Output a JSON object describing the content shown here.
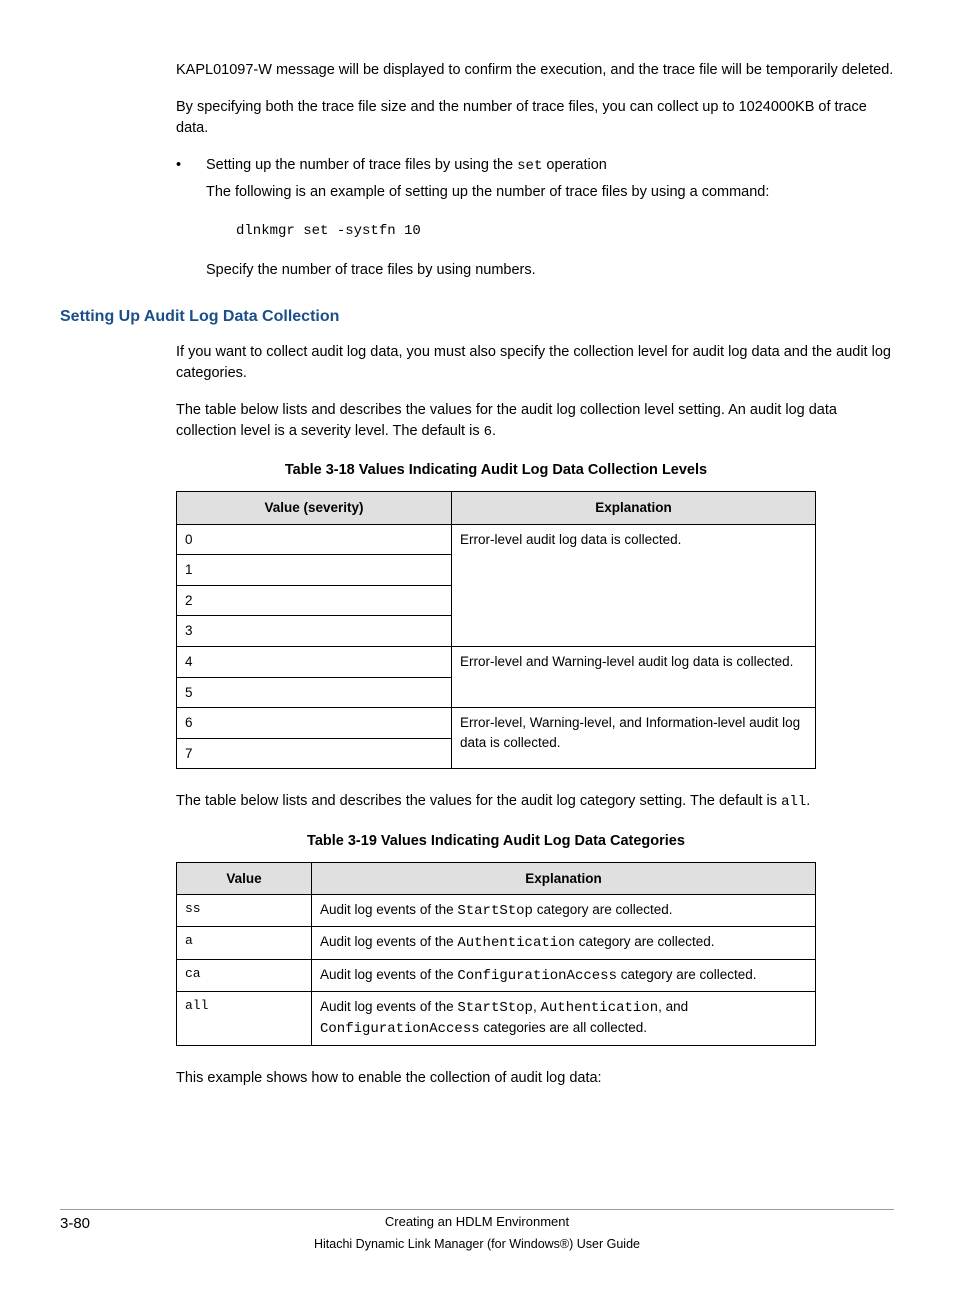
{
  "para1": "KAPL01097-W message will be displayed to confirm the execution, and the trace file will be temporarily deleted.",
  "para2": "By specifying both the trace file size and the number of trace files, you can collect up to 1024000KB of trace data.",
  "bullet": {
    "marker": "•",
    "line1_pre": "Setting up the number of trace files by using the ",
    "line1_code": "set",
    "line1_post": " operation",
    "line2": "The following is an example of setting up the number of trace files by using a command:",
    "code": "dlnkmgr set -systfn 10",
    "line3": "Specify the number of trace files by using numbers."
  },
  "heading": "Setting Up Audit Log Data Collection",
  "para3": "If you want to collect audit log data, you must also specify the collection level for audit log data and the audit log categories.",
  "para4_pre": "The table below lists and describes the values for the audit log collection level setting. An audit log data collection level is a severity level. The default is ",
  "para4_code": "6",
  "para4_post": ".",
  "table1": {
    "caption": "Table 3-18 Values Indicating Audit Log Data Collection Levels",
    "h1": "Value (severity)",
    "h2": "Explanation",
    "r0v": "0",
    "r1v": "1",
    "r2v": "2",
    "r3v": "3",
    "g1e": "Error-level audit log data is collected.",
    "r4v": "4",
    "r5v": "5",
    "g2e": "Error-level and Warning-level audit log data is collected.",
    "r6v": "6",
    "r7v": "7",
    "g3e": "Error-level, Warning-level, and Information-level audit log data is collected."
  },
  "para5_pre": "The table below lists and describes the values for the audit log category setting. The default is ",
  "para5_code": "all",
  "para5_post": ".",
  "table2": {
    "caption": "Table 3-19 Values Indicating Audit Log Data Categories",
    "h1": "Value",
    "h2": "Explanation",
    "r0v": "ss",
    "r0e_pre": "Audit log events of the ",
    "r0e_code": "StartStop",
    "r0e_post": " category are collected.",
    "r1v": "a",
    "r1e_pre": "Audit log events of the ",
    "r1e_code": "Authentication",
    "r1e_post": " category are collected.",
    "r2v": "ca",
    "r2e_pre": "Audit log events of the ",
    "r2e_code": "ConfigurationAccess",
    "r2e_post": " category are collected.",
    "r3v": "all",
    "r3e_pre": "Audit log events of the ",
    "r3e_c1": "StartStop",
    "r3e_m1": ", ",
    "r3e_c2": "Authentication",
    "r3e_m2": ", and ",
    "r3e_c3": "ConfigurationAccess",
    "r3e_post": " categories are all collected."
  },
  "para6": "This example shows how to enable the collection of audit log data:",
  "footer": {
    "page": "3-80",
    "title": "Creating an HDLM Environment",
    "sub": "Hitachi Dynamic Link Manager (for Windows®) User Guide"
  }
}
